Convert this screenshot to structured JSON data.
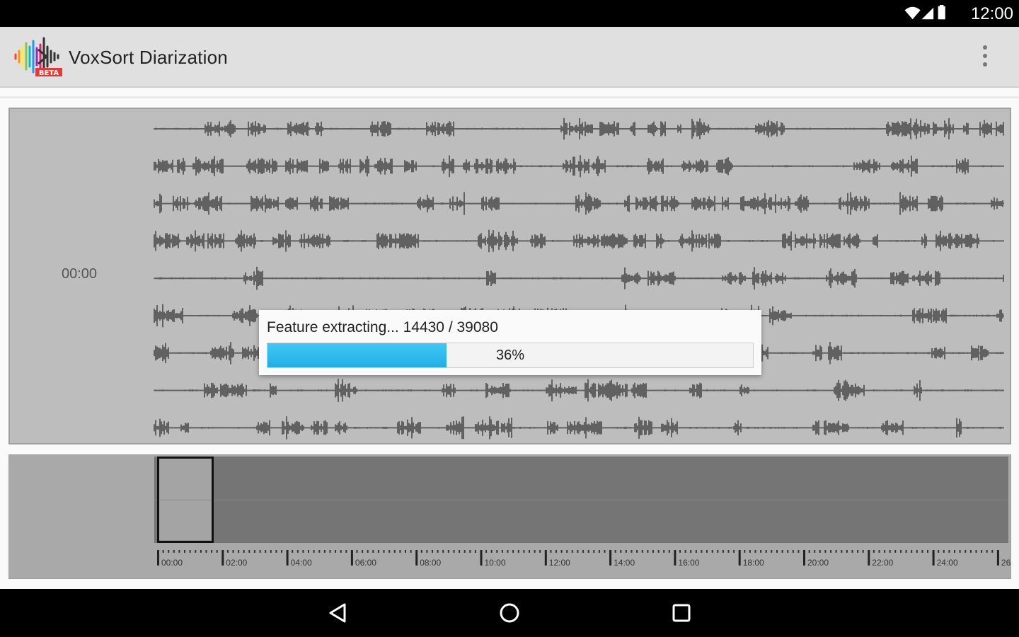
{
  "status_bar": {
    "time": "12:00",
    "icons": [
      "wifi-icon",
      "cell-signal-icon",
      "battery-icon"
    ]
  },
  "action_bar": {
    "title": "VoxSort Diarization",
    "logo_badge": "BETA",
    "menu_icon": "overflow-menu-icon"
  },
  "waveform": {
    "time_label": "00:00"
  },
  "progress_dialog": {
    "message": "Feature extracting... 14430 / 39080",
    "percent_label": "36%",
    "progress": 0.369
  },
  "overview": {
    "ruler_labels": [
      "00:00",
      "02:00",
      "04:00",
      "06:00",
      "08:00",
      "10:00",
      "12:00",
      "14:00",
      "16:00",
      "18:00",
      "20:00",
      "22:00",
      "24:00",
      "26"
    ]
  },
  "nav_bar": {
    "icons": [
      "back-icon",
      "home-icon",
      "recents-icon"
    ]
  },
  "colors": {
    "progress_fill": "#29b6f6",
    "waveform": "#616161",
    "panel_bg": "#bdbdbd",
    "overview_track": "#757575"
  }
}
